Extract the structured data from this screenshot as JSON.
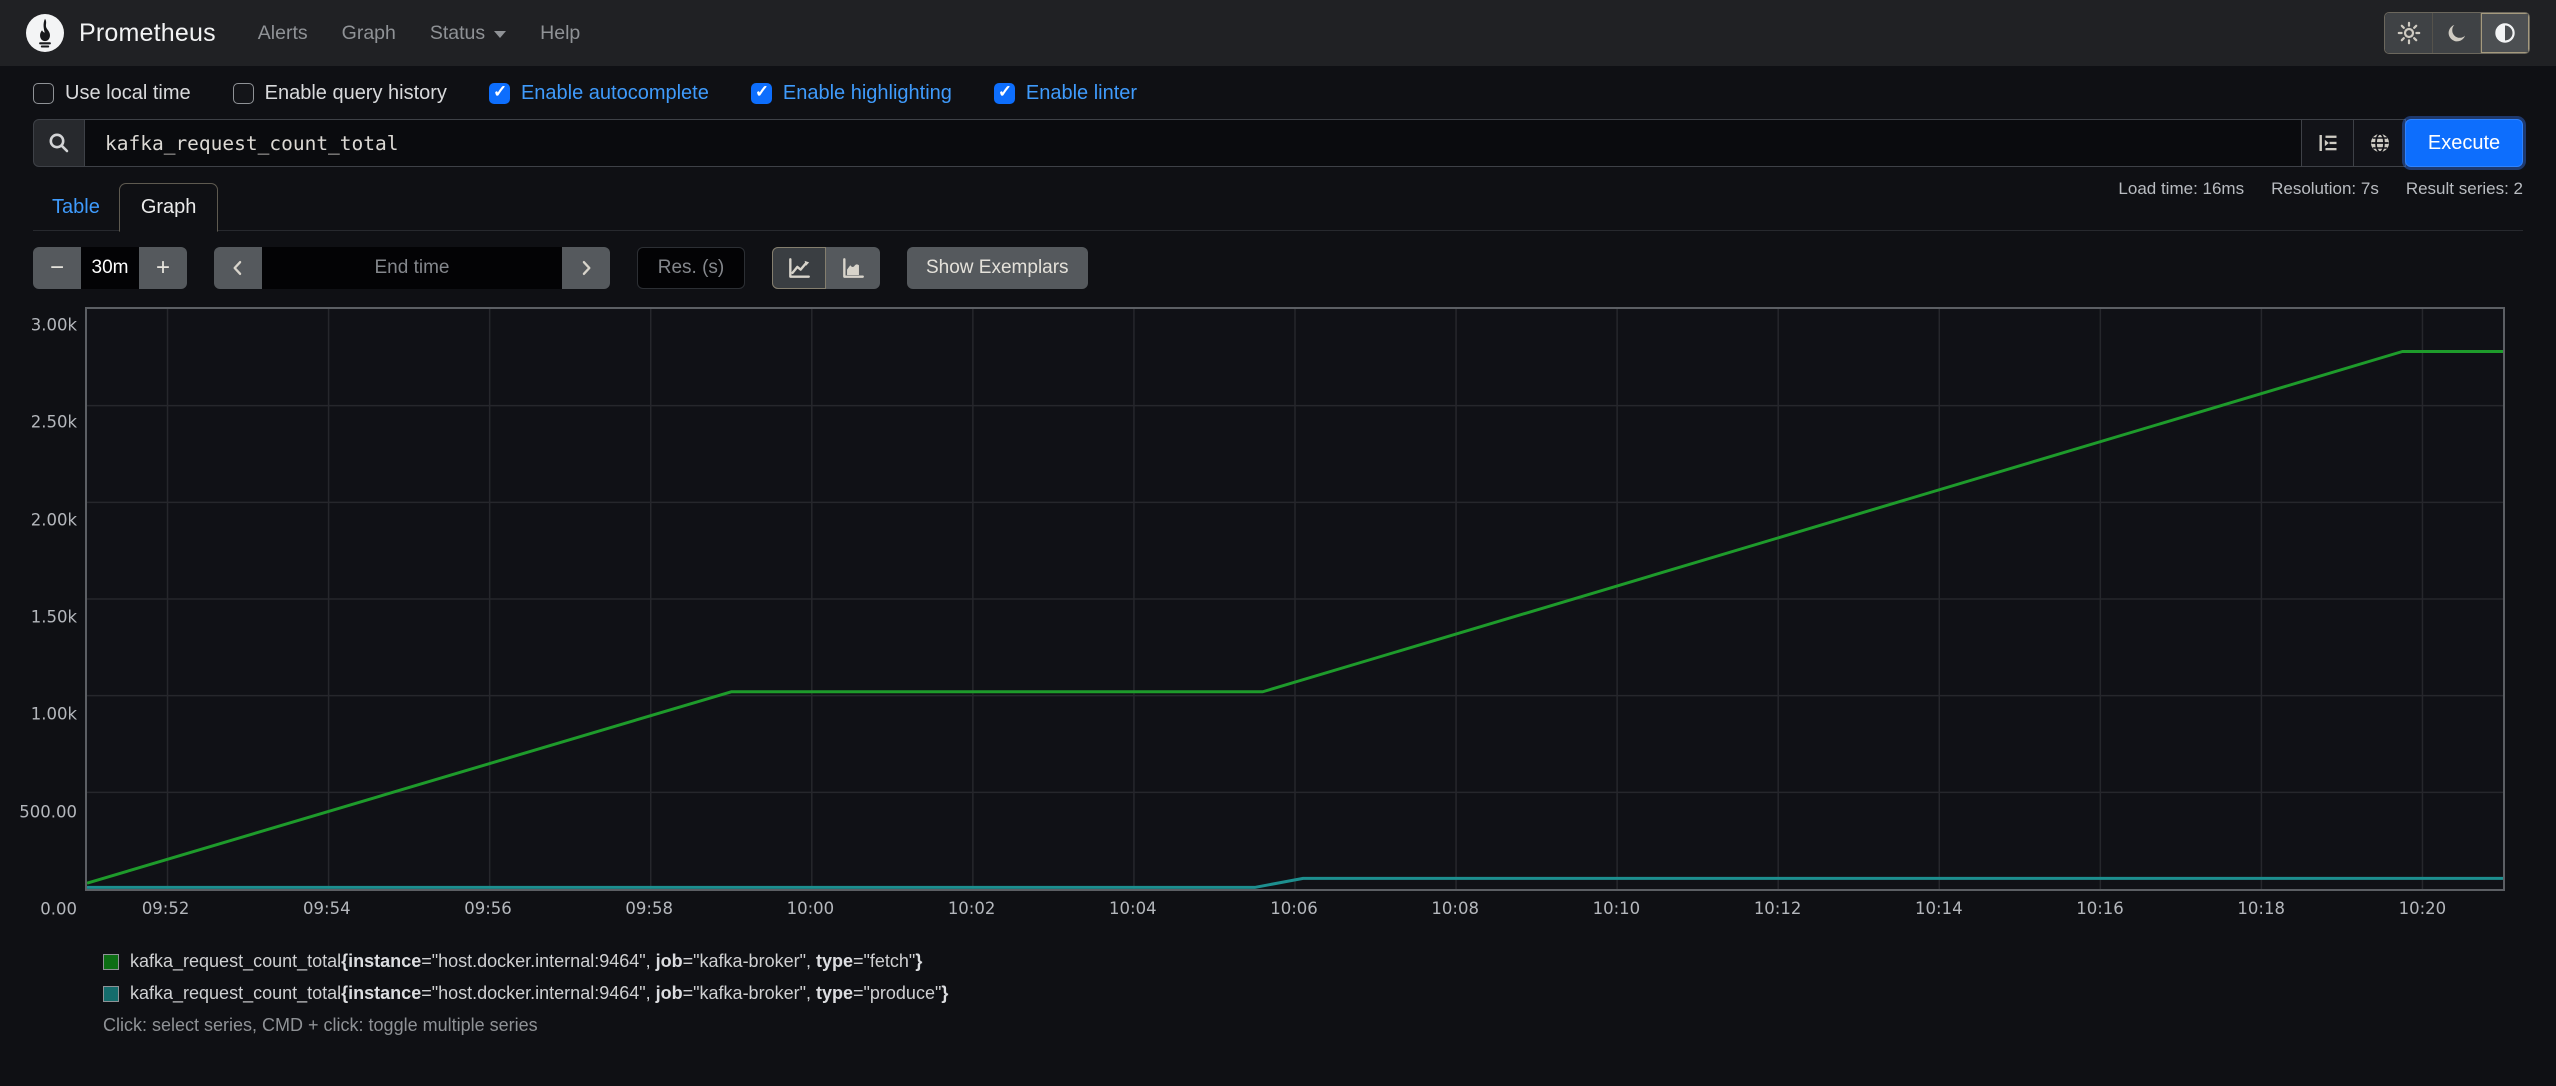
{
  "navbar": {
    "brand": "Prometheus",
    "items": [
      {
        "label": "Alerts",
        "caret": false
      },
      {
        "label": "Graph",
        "caret": false
      },
      {
        "label": "Status",
        "caret": true
      },
      {
        "label": "Help",
        "caret": false
      }
    ],
    "theme_options": [
      {
        "name": "light",
        "icon": "sun-icon",
        "active": false
      },
      {
        "name": "dark",
        "icon": "moon-icon",
        "active": false
      },
      {
        "name": "auto",
        "icon": "half-circle-icon",
        "active": true
      }
    ]
  },
  "options": {
    "items": [
      {
        "label": "Use local time",
        "checked": false
      },
      {
        "label": "Enable query history",
        "checked": false
      },
      {
        "label": "Enable autocomplete",
        "checked": true
      },
      {
        "label": "Enable highlighting",
        "checked": true
      },
      {
        "label": "Enable linter",
        "checked": true
      }
    ]
  },
  "query": {
    "value": "kafka_request_count_total",
    "execute_label": "Execute"
  },
  "stats": {
    "load_time": "Load time: 16ms",
    "resolution": "Resolution: 7s",
    "result_series": "Result series: 2"
  },
  "tabs": [
    {
      "label": "Table",
      "active": false
    },
    {
      "label": "Graph",
      "active": true
    }
  ],
  "controls": {
    "decrease_label": "−",
    "increase_label": "+",
    "range_value": "30m",
    "end_time_placeholder": "End time",
    "res_placeholder": "Res. (s)",
    "show_exemplars_label": "Show Exemplars",
    "graph_type_options": [
      {
        "name": "line",
        "icon": "line-chart-icon",
        "active": true
      },
      {
        "name": "stacked",
        "icon": "area-chart-icon",
        "active": false
      }
    ]
  },
  "colors": {
    "accent_blue": "#0d6efd",
    "link_blue": "#3f9bfc",
    "series_green": "#1e9b2b",
    "series_teal": "#1d8f8f",
    "grid": "#26272c"
  },
  "chart_data": {
    "type": "line",
    "title": "",
    "xlabel": "",
    "ylabel": "",
    "x_axis": {
      "start_time": "09:51",
      "end_time": "10:21",
      "range_minutes": 30,
      "unit": "minutes_after_start",
      "ticks": [
        {
          "label": "09:52",
          "minute": 1
        },
        {
          "label": "09:54",
          "minute": 3
        },
        {
          "label": "09:56",
          "minute": 5
        },
        {
          "label": "09:58",
          "minute": 7
        },
        {
          "label": "10:00",
          "minute": 9
        },
        {
          "label": "10:02",
          "minute": 11
        },
        {
          "label": "10:04",
          "minute": 13
        },
        {
          "label": "10:06",
          "minute": 15
        },
        {
          "label": "10:08",
          "minute": 17
        },
        {
          "label": "10:10",
          "minute": 19
        },
        {
          "label": "10:12",
          "minute": 21
        },
        {
          "label": "10:14",
          "minute": 23
        },
        {
          "label": "10:16",
          "minute": 25
        },
        {
          "label": "10:18",
          "minute": 27
        },
        {
          "label": "10:20",
          "minute": 29
        }
      ]
    },
    "y_axis": {
      "min": 0,
      "max": 3000,
      "ticks": [
        {
          "label": "0.00",
          "value": 0
        },
        {
          "label": "500.00",
          "value": 500
        },
        {
          "label": "1.00k",
          "value": 1000
        },
        {
          "label": "1.50k",
          "value": 1500
        },
        {
          "label": "2.00k",
          "value": 2000
        },
        {
          "label": "2.50k",
          "value": 2500
        },
        {
          "label": "3.00k",
          "value": 3000
        }
      ]
    },
    "grid": true,
    "legend_position": "bottom",
    "series": [
      {
        "name": "kafka_request_count_total{instance=\"host.docker.internal:9464\", job=\"kafka-broker\", type=\"fetch\"}",
        "color": "#1e9b2b",
        "points": [
          [
            0,
            30
          ],
          [
            8,
            1020
          ],
          [
            14.6,
            1020
          ],
          [
            28.75,
            2780
          ],
          [
            30,
            2780
          ]
        ]
      },
      {
        "name": "kafka_request_count_total{instance=\"host.docker.internal:9464\", job=\"kafka-broker\", type=\"produce\"}",
        "color": "#1d8f8f",
        "points": [
          [
            0,
            8
          ],
          [
            14.5,
            8
          ],
          [
            15.1,
            55
          ],
          [
            30,
            55
          ]
        ]
      }
    ]
  },
  "legend": {
    "series": [
      {
        "swatch_color": "#0c6e14",
        "metric": "kafka_request_count_total",
        "labels": [
          {
            "key": "instance",
            "value": "host.docker.internal:9464"
          },
          {
            "key": "job",
            "value": "kafka-broker"
          },
          {
            "key": "type",
            "value": "fetch"
          }
        ]
      },
      {
        "swatch_color": "#156c6c",
        "metric": "kafka_request_count_total",
        "labels": [
          {
            "key": "instance",
            "value": "host.docker.internal:9464"
          },
          {
            "key": "job",
            "value": "kafka-broker"
          },
          {
            "key": "type",
            "value": "produce"
          }
        ]
      }
    ],
    "hint": "Click: select series, CMD + click: toggle multiple series"
  }
}
